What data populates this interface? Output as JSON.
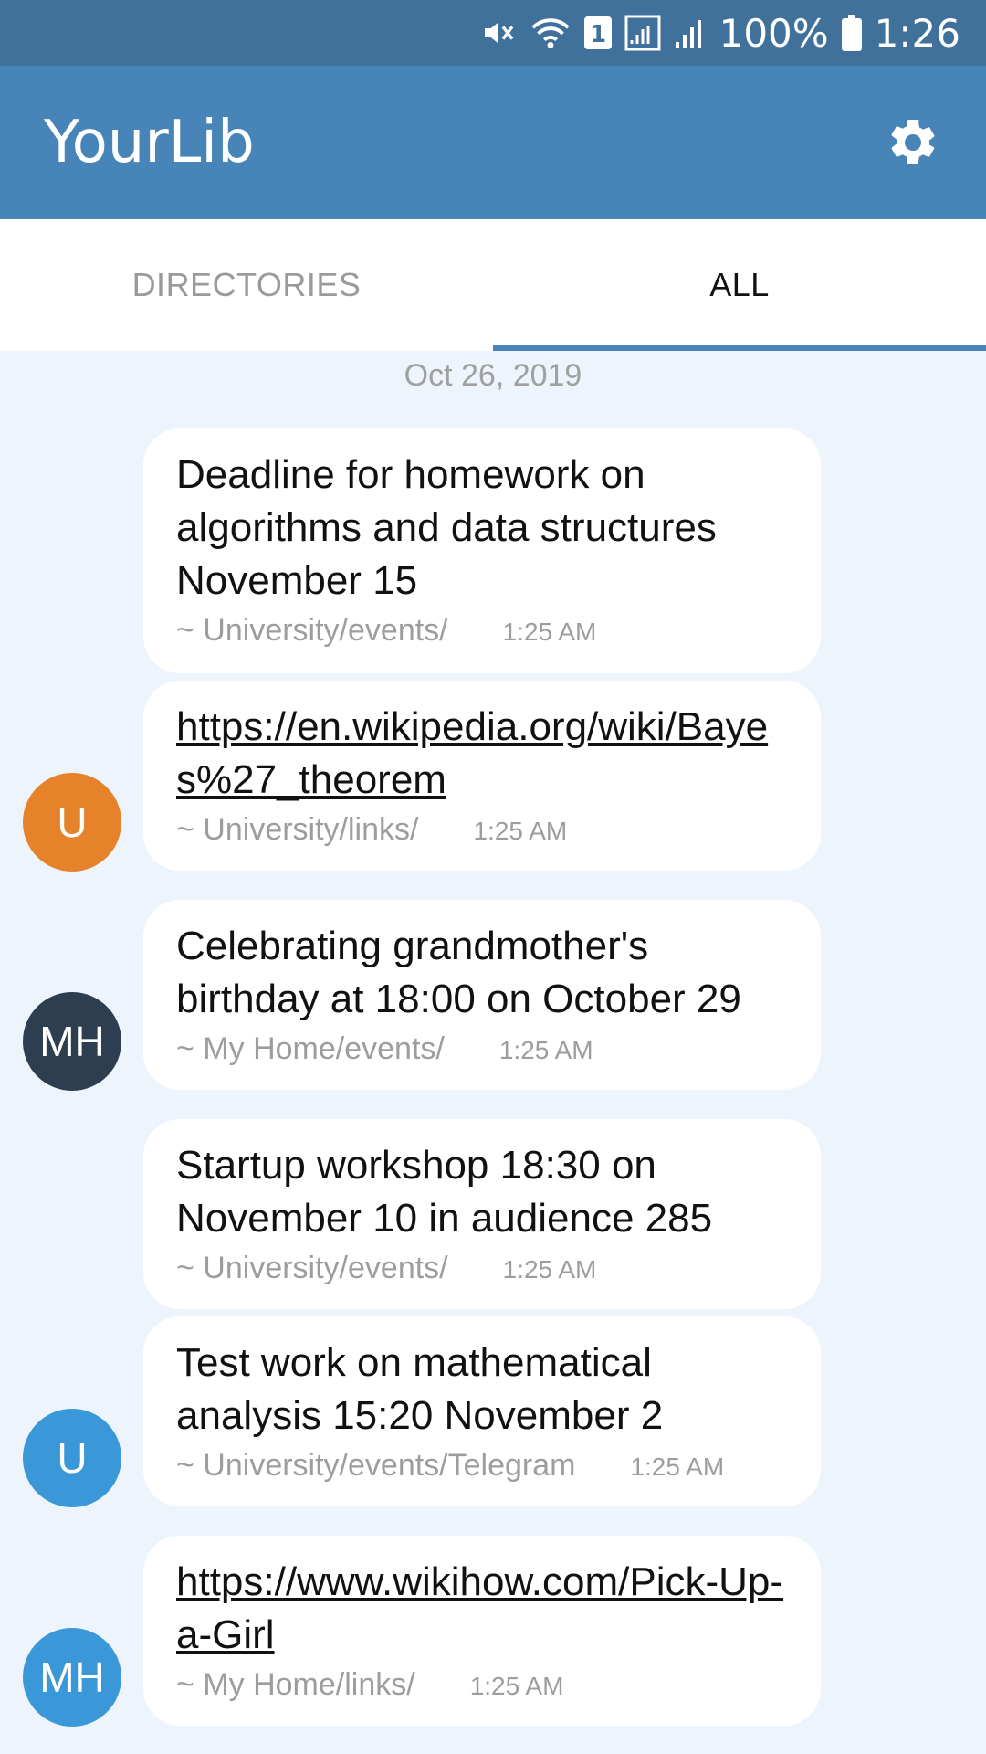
{
  "status_bar": {
    "battery": "100%",
    "time": "1:26",
    "sim_badge": "1"
  },
  "app_bar": {
    "title": "YourLib"
  },
  "tabs": [
    {
      "label": "DIRECTORIES",
      "active": false
    },
    {
      "label": "ALL",
      "active": true
    }
  ],
  "date": "Oct 26, 2019",
  "messages": [
    {
      "text": "Deadline for homework on algorithms and data structures November 15",
      "path": "~ University/events/",
      "time": "1:25 AM",
      "link": false
    },
    {
      "text": "https://en.wikipedia.org/wiki/Bayes%27_theorem",
      "path": "~ University/links/",
      "time": "1:25 AM",
      "link": true
    },
    {
      "text": "Celebrating grandmother's birthday at 18:00 on October 29",
      "path": "~ My Home/events/",
      "time": "1:25 AM",
      "link": false
    },
    {
      "text": "Startup workshop 18:30 on November 10 in audience 285",
      "path": "~ University/events/",
      "time": "1:25 AM",
      "link": false
    },
    {
      "text": "Test work on mathematical analysis 15:20 November 2",
      "path": "~ University/events/Telegram",
      "time": "1:25 AM",
      "link": false
    },
    {
      "text": "https://www.wikihow.com/Pick-Up-a-Girl",
      "path": "~ My Home/links/",
      "time": "1:25 AM",
      "link": true
    }
  ],
  "avatars": [
    {
      "initials": "U",
      "color": "#e5822a"
    },
    {
      "initials": "MH",
      "color": "#2d3e50"
    },
    {
      "initials": "U",
      "color": "#3a97d8"
    },
    {
      "initials": "MH",
      "color": "#3a97d8"
    }
  ],
  "colors": {
    "status_bar": "#3f719b",
    "app_bar": "#4784b8",
    "background": "#edf4fb",
    "tab_indicator": "#4784b8"
  },
  "icons": [
    "mute-icon",
    "wifi-icon",
    "signal-icon",
    "battery-icon",
    "settings-gear-icon"
  ]
}
